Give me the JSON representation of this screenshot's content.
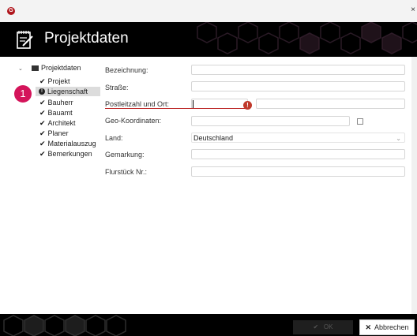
{
  "window": {
    "app_icon": "logo-icon",
    "close_glyph": "×"
  },
  "header": {
    "title": "Projektdaten",
    "icon": "notepad-icon"
  },
  "tree": {
    "root_label": "Projektdaten",
    "items": [
      {
        "label": "Projekt",
        "status": "check"
      },
      {
        "label": "Liegenschaft",
        "status": "error",
        "selected": true
      },
      {
        "label": "Bauherr",
        "status": "check"
      },
      {
        "label": "Bauamt",
        "status": "check"
      },
      {
        "label": "Architekt",
        "status": "check"
      },
      {
        "label": "Planer",
        "status": "check"
      },
      {
        "label": "Materialauszug",
        "status": "check"
      },
      {
        "label": "Bemerkungen",
        "status": "check"
      }
    ]
  },
  "annotation": {
    "badge": "1"
  },
  "form": {
    "bezeichnung_label": "Bezeichnung:",
    "strasse_label": "Straße:",
    "plz_ort_label": "Postleitzahl und Ort:",
    "geo_label": "Geo-Koordinaten:",
    "land_label": "Land:",
    "land_value": "Deutschland",
    "gemarkung_label": "Gemarkung:",
    "flurstueck_label": "Flurstück Nr.:",
    "error_glyph": "!"
  },
  "footer": {
    "ok_label": "OK",
    "cancel_label": "Abbrechen"
  },
  "colors": {
    "error": "#c0392b",
    "badge": "#d4145a",
    "header_bg": "#000000"
  }
}
